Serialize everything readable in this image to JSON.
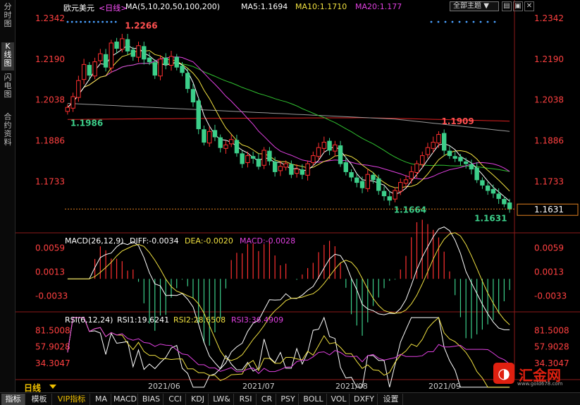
{
  "sidebar": {
    "tabs": [
      {
        "label": "分时图",
        "active": false
      },
      {
        "label": "K线图",
        "active": true
      },
      {
        "label": "闪电图",
        "active": false
      },
      {
        "label": "合约资料",
        "active": false
      }
    ]
  },
  "header": {
    "symbol": "欧元美元",
    "period_tag": "<日线>",
    "ma_label": "MA(5,10,20,50,100,200)",
    "ma5": "MA5:1.1694",
    "ma10": "MA10:1.1710",
    "ma20": "MA20:1.177",
    "theme_button": "全部主题",
    "window_controls": [
      "▤",
      "▣",
      "✕"
    ]
  },
  "colors": {
    "up": "#ff3030",
    "down": "#3ccf8a",
    "ma5": "#ffffff",
    "ma10": "#f0e040",
    "ma20": "#e040e0",
    "ma50": "#30c030",
    "ma100": "#9a9a9a",
    "ma200": "#e02020",
    "price_axis": "#ff4040",
    "accent": "#f0c000"
  },
  "chart_data": [
    {
      "type": "candlestick",
      "title": "欧元美元 <日线>",
      "x": [
        "2021/06",
        "2021/07",
        "2021/08",
        "2021/09"
      ],
      "y_ticks": [
        "1.2342",
        "1.2190",
        "1.2038",
        "1.1886",
        "1.1733"
      ],
      "ylim": [
        1.16,
        1.2342
      ],
      "close_series": [
        1.201,
        1.205,
        1.211,
        1.217,
        1.213,
        1.218,
        1.221,
        1.216,
        1.225,
        1.223,
        1.2266,
        1.222,
        1.22,
        1.224,
        1.219,
        1.218,
        1.213,
        1.219,
        1.217,
        1.22,
        1.216,
        1.214,
        1.208,
        1.203,
        1.193,
        1.188,
        1.192,
        1.19,
        1.186,
        1.187,
        1.189,
        1.184,
        1.18,
        1.183,
        1.182,
        1.179,
        1.185,
        1.181,
        1.177,
        1.179,
        1.18,
        1.176,
        1.178,
        1.176,
        1.18,
        1.183,
        1.186,
        1.188,
        1.185,
        1.187,
        1.18,
        1.177,
        1.175,
        1.173,
        1.171,
        1.176,
        1.174,
        1.17,
        1.168,
        1.1664,
        1.17,
        1.173,
        1.174,
        1.177,
        1.18,
        1.183,
        1.186,
        1.188,
        1.1909,
        1.185,
        1.183,
        1.182,
        1.181,
        1.18,
        1.178,
        1.174,
        1.172,
        1.17,
        1.169,
        1.167,
        1.165,
        1.1631
      ],
      "price_labels": [
        {
          "text": "1.2266",
          "kind": "high"
        },
        {
          "text": "1.1986",
          "kind": "low"
        },
        {
          "text": "1.1909",
          "kind": "high"
        },
        {
          "text": "1.1664",
          "kind": "low"
        },
        {
          "text": "1.1631",
          "kind": "low"
        }
      ],
      "last_price": "1.1631"
    },
    {
      "type": "macd",
      "title": "MACD(26,12,9)",
      "diff": "DIFF:-0.0034",
      "dea": "DEA:-0.0020",
      "macd": "MACD:-0.0028",
      "y_ticks": [
        "0.0059",
        "0.0013",
        "-0.0033"
      ]
    },
    {
      "type": "rsi",
      "title": "RSI(6,12,24)",
      "rsi1": "RSI1:19.6241",
      "rsi2": "RSI2:28.6508",
      "rsi3": "RSI3:36.4909",
      "y_ticks": [
        "81.5008",
        "57.9028",
        "34.3047"
      ]
    }
  ],
  "period": {
    "label": "日线"
  },
  "bottom_tabs": [
    {
      "label": "指标",
      "active": true,
      "vip": false
    },
    {
      "label": "模板",
      "active": false,
      "vip": false
    },
    {
      "label": "VIP指标",
      "active": false,
      "vip": true
    },
    {
      "label": "MA",
      "active": false,
      "vip": false
    },
    {
      "label": "MACD",
      "active": false,
      "vip": false
    },
    {
      "label": "BIAS",
      "active": false,
      "vip": false
    },
    {
      "label": "CCI",
      "active": false,
      "vip": false
    },
    {
      "label": "KDJ",
      "active": false,
      "vip": false
    },
    {
      "label": "LW&",
      "active": false,
      "vip": false
    },
    {
      "label": "RSI",
      "active": false,
      "vip": false
    },
    {
      "label": "CR",
      "active": false,
      "vip": false
    },
    {
      "label": "PSY",
      "active": false,
      "vip": false
    },
    {
      "label": "BOLL",
      "active": false,
      "vip": false
    },
    {
      "label": "VOL",
      "active": false,
      "vip": false
    },
    {
      "label": "DXFY",
      "active": false,
      "vip": false
    },
    {
      "label": "设置",
      "active": false,
      "vip": false
    }
  ],
  "logo": {
    "text": "汇金网",
    "url": "www.gold678.com",
    "icon": "gold-logo-icon"
  }
}
